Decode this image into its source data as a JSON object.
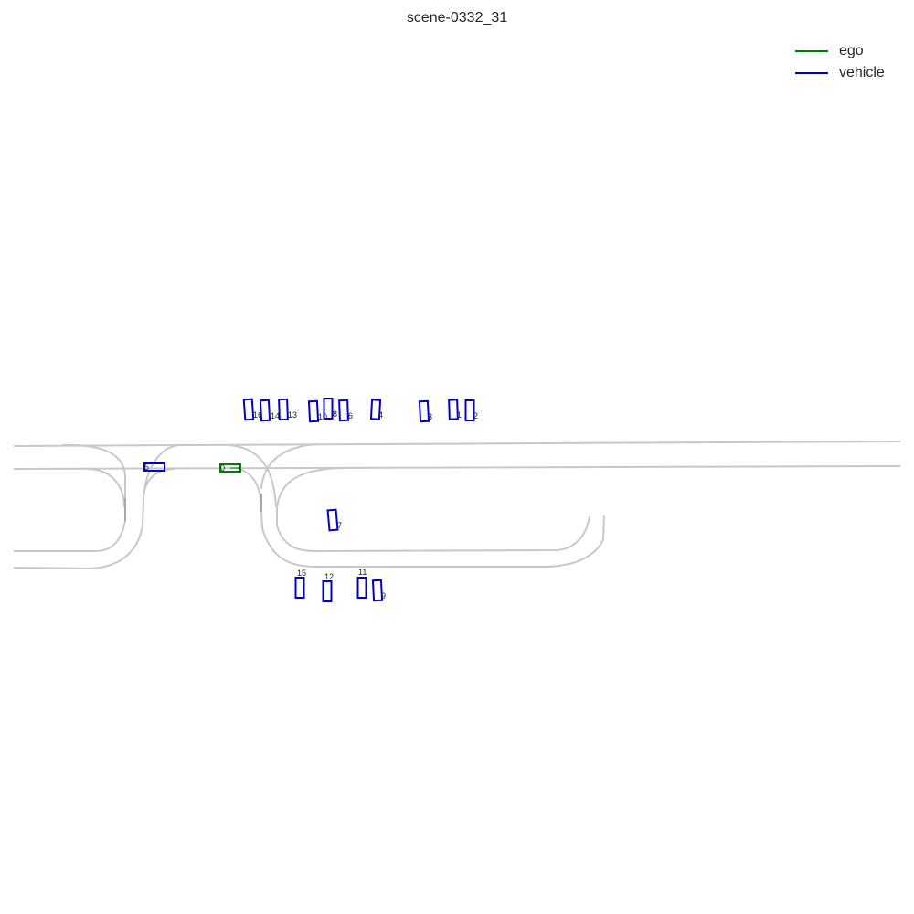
{
  "title": "scene-0332_31",
  "legend": {
    "items": [
      {
        "label": "ego",
        "color": "#008000"
      },
      {
        "label": "vehicle",
        "color": "#0000d0"
      }
    ]
  },
  "colors": {
    "road": "#c8c8c8",
    "road_dark": "#a8a8a8",
    "ego": "#008000",
    "vehicle": "#0000d0"
  },
  "objects": [
    {
      "id": "0",
      "category": "ego"
    },
    {
      "id": "1",
      "category": "vehicle"
    },
    {
      "id": "2",
      "category": "vehicle"
    },
    {
      "id": "3",
      "category": "vehicle"
    },
    {
      "id": "4",
      "category": "vehicle"
    },
    {
      "id": "5",
      "category": "vehicle"
    },
    {
      "id": "6",
      "category": "vehicle"
    },
    {
      "id": "7",
      "category": "vehicle"
    },
    {
      "id": "8",
      "category": "vehicle"
    },
    {
      "id": "9",
      "category": "vehicle"
    },
    {
      "id": "10",
      "category": "vehicle"
    },
    {
      "id": "11",
      "category": "vehicle"
    },
    {
      "id": "12",
      "category": "vehicle"
    },
    {
      "id": "13",
      "category": "vehicle"
    },
    {
      "id": "14",
      "category": "vehicle"
    },
    {
      "id": "15",
      "category": "vehicle"
    },
    {
      "id": "16",
      "category": "vehicle"
    }
  ]
}
